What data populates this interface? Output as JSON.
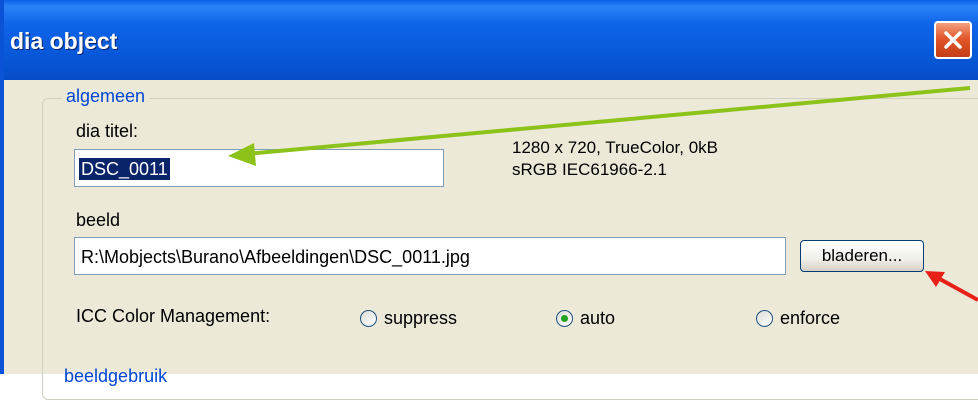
{
  "window": {
    "title": "dia object"
  },
  "group": {
    "label": "algemeen",
    "next_label_partial": "beeldgebruik"
  },
  "title_field": {
    "label": "dia titel:",
    "value": "DSC_0011"
  },
  "image_info": {
    "line1": "1280 x 720, TrueColor, 0kB",
    "line2": "sRGB IEC61966-2.1"
  },
  "image_field": {
    "label": "beeld",
    "value": "R:\\Mobjects\\Burano\\Afbeeldingen\\DSC_0011.jpg",
    "browse_label": "bladeren..."
  },
  "color_management": {
    "label": "ICC Color Management:",
    "options": [
      "suppress",
      "auto",
      "enforce"
    ],
    "selected": "auto"
  },
  "colors": {
    "titlebar": "#0758d8",
    "group_label": "#0046d5",
    "arrow_green": "#8cc21a",
    "arrow_red": "#e8201a"
  }
}
